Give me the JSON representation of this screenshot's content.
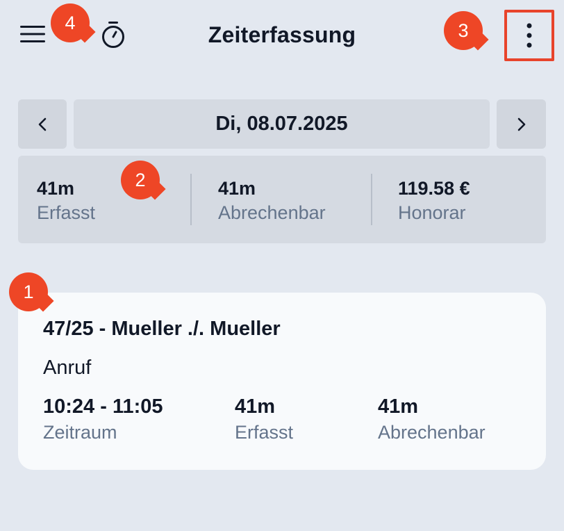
{
  "header": {
    "title": "Zeiterfassung",
    "menu_icon": "hamburger-menu-icon",
    "timer_icon": "stopwatch-icon",
    "more_icon": "more-vertical-icon"
  },
  "date_nav": {
    "date_label": "Di, 08.07.2025",
    "prev_icon": "chevron-left-icon",
    "next_icon": "chevron-right-icon"
  },
  "summary": {
    "items": [
      {
        "value": "41m",
        "label": "Erfasst"
      },
      {
        "value": "41m",
        "label": "Abrechenbar"
      },
      {
        "value": "119.58 €",
        "label": "Honorar"
      }
    ]
  },
  "entries": [
    {
      "title": "47/25 - Mueller ./. Mueller",
      "activity": "Anruf",
      "stats": [
        {
          "value": "10:24 - 11:05",
          "label": "Zeitraum"
        },
        {
          "value": "41m",
          "label": "Erfasst"
        },
        {
          "value": "41m",
          "label": "Abrechenbar"
        }
      ]
    }
  ],
  "markers": [
    "1",
    "2",
    "3",
    "4"
  ],
  "colors": {
    "background": "#e3e8f0",
    "panel": "#d5dae2",
    "card": "#f8fafc",
    "marker": "#ee4626",
    "highlight_border": "#e8432b",
    "muted_text": "#64748b"
  }
}
